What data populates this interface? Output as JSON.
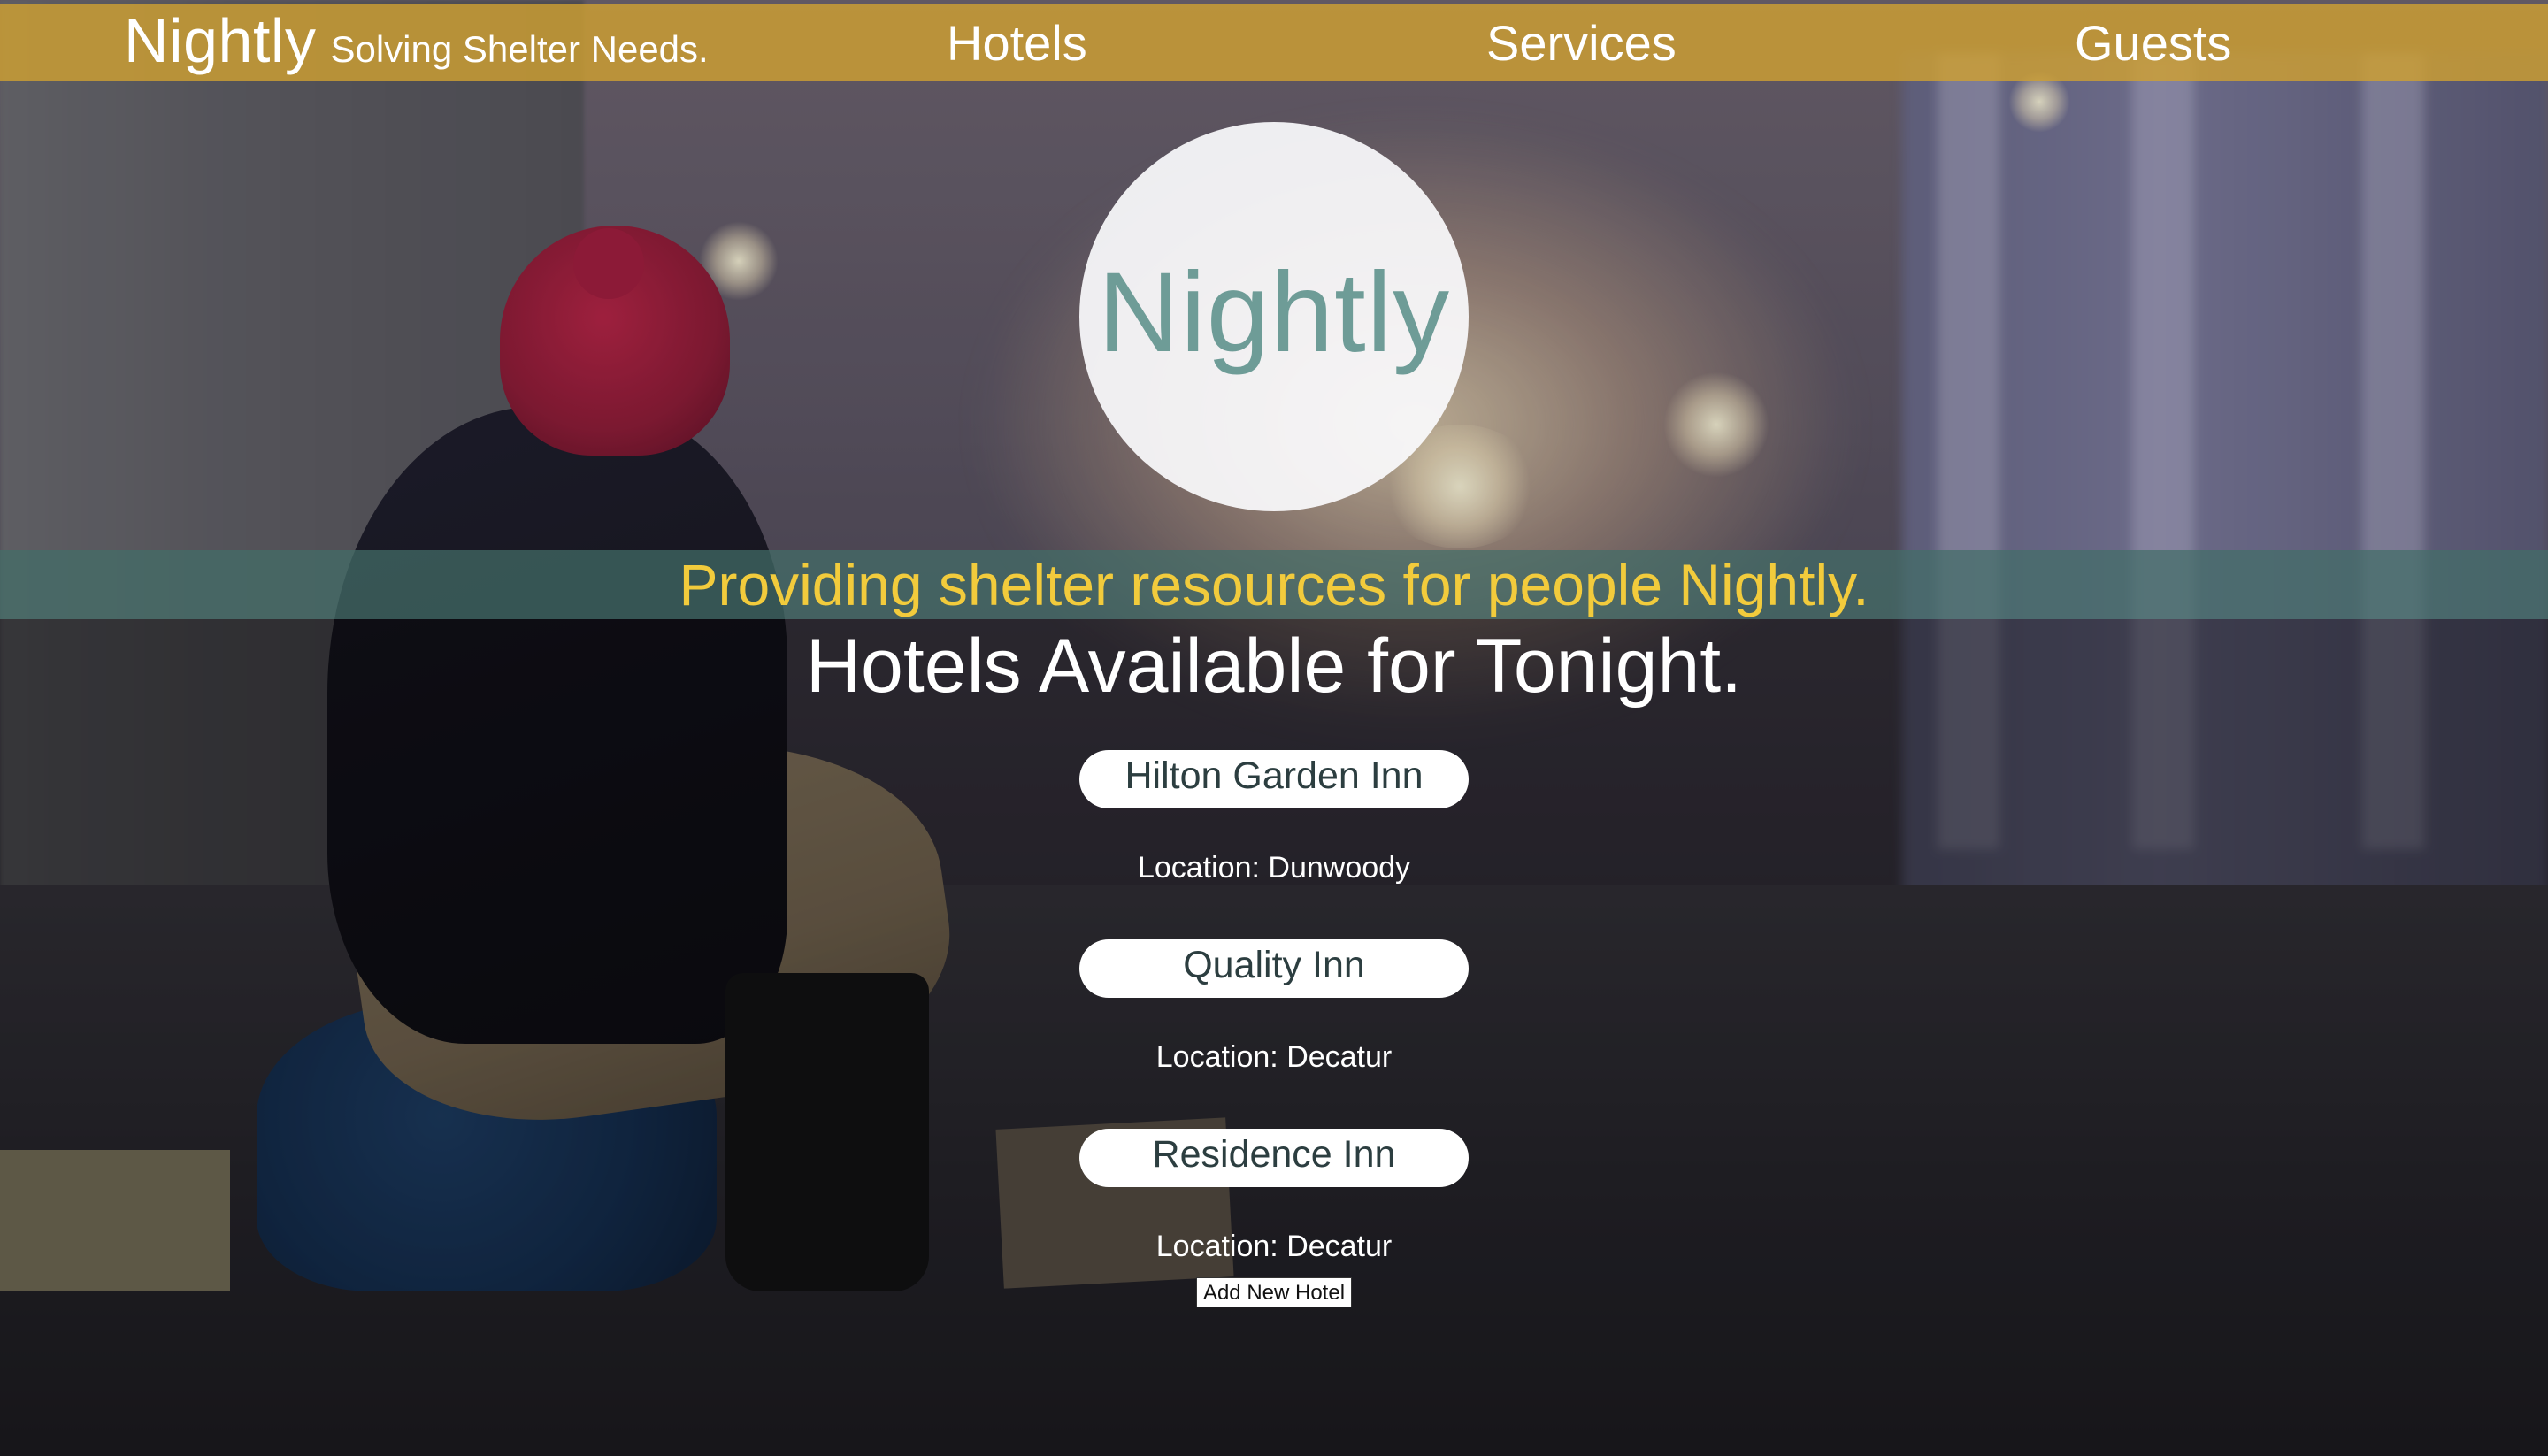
{
  "nav": {
    "brand": "Nightly",
    "tagline": "Solving Shelter Needs.",
    "links": [
      "Hotels",
      "Services",
      "Guests"
    ]
  },
  "logo": {
    "text": "Nightly"
  },
  "hero": {
    "tagline": "Providing shelter resources for people Nightly."
  },
  "hotels_section": {
    "title": "Hotels Available for Tonight.",
    "hotels": [
      {
        "name": "Hilton Garden Inn",
        "location": "Location: Dunwoody"
      },
      {
        "name": "Quality Inn",
        "location": "Location: Decatur"
      },
      {
        "name": "Residence Inn",
        "location": "Location: Decatur"
      }
    ],
    "add_button": "Add New Hotel"
  },
  "colors": {
    "nav_bar": "#cea032",
    "logo_text": "#6e9c97",
    "tagline_text": "#f2cb3c",
    "tagline_band": "#426e68"
  }
}
